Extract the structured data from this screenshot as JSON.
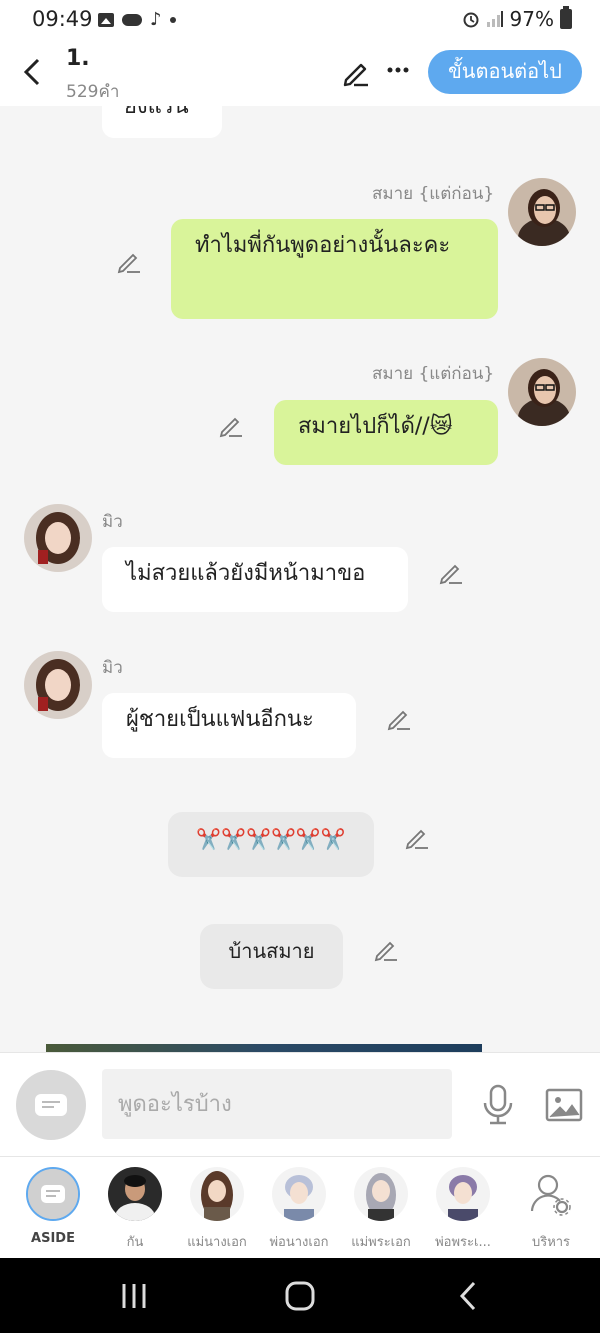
{
  "status": {
    "time": "09:49",
    "battery": "97%"
  },
  "header": {
    "title": "1.",
    "word_count": "529คำ",
    "next_label": "ขั้นตอนต่อไป",
    "next_color": "#5ea9ef"
  },
  "chat": {
    "top_partial": "ยงแรน",
    "messages": [
      {
        "sender": "สมาย {แต่ก่อน}",
        "text": "ทำไมพี่กันพูดอย่างนั้นละคะ",
        "side": "right"
      },
      {
        "sender": "สมาย {แต่ก่อน}",
        "text": "สมายไปก็ได้//😿",
        "side": "right"
      },
      {
        "sender": "มิว",
        "text": "ไม่สวยแล้วยังมีหน้ามาขอ",
        "side": "left"
      },
      {
        "sender": "มิว",
        "text": "ผู้ชายเป็นแฟนอีกนะ",
        "side": "left"
      },
      {
        "text": "✂️✂️✂️✂️✂️✂️",
        "side": "center"
      },
      {
        "text": "บ้านสมาย",
        "side": "center"
      }
    ],
    "bubble_green": "#d9f49a"
  },
  "input": {
    "placeholder": "พูดอะไรบ้าง"
  },
  "characters": [
    {
      "label": "ASIDE",
      "icon": "aside-icon"
    },
    {
      "label": "กัน",
      "icon": "avatar"
    },
    {
      "label": "แม่นางเอก",
      "icon": "avatar"
    },
    {
      "label": "พ่อนางเอก",
      "icon": "avatar"
    },
    {
      "label": "แม่พระเอก",
      "icon": "avatar"
    },
    {
      "label": "พ่อพระเ...",
      "icon": "avatar"
    },
    {
      "label": "บริหาร",
      "icon": "manage-user-icon"
    }
  ]
}
